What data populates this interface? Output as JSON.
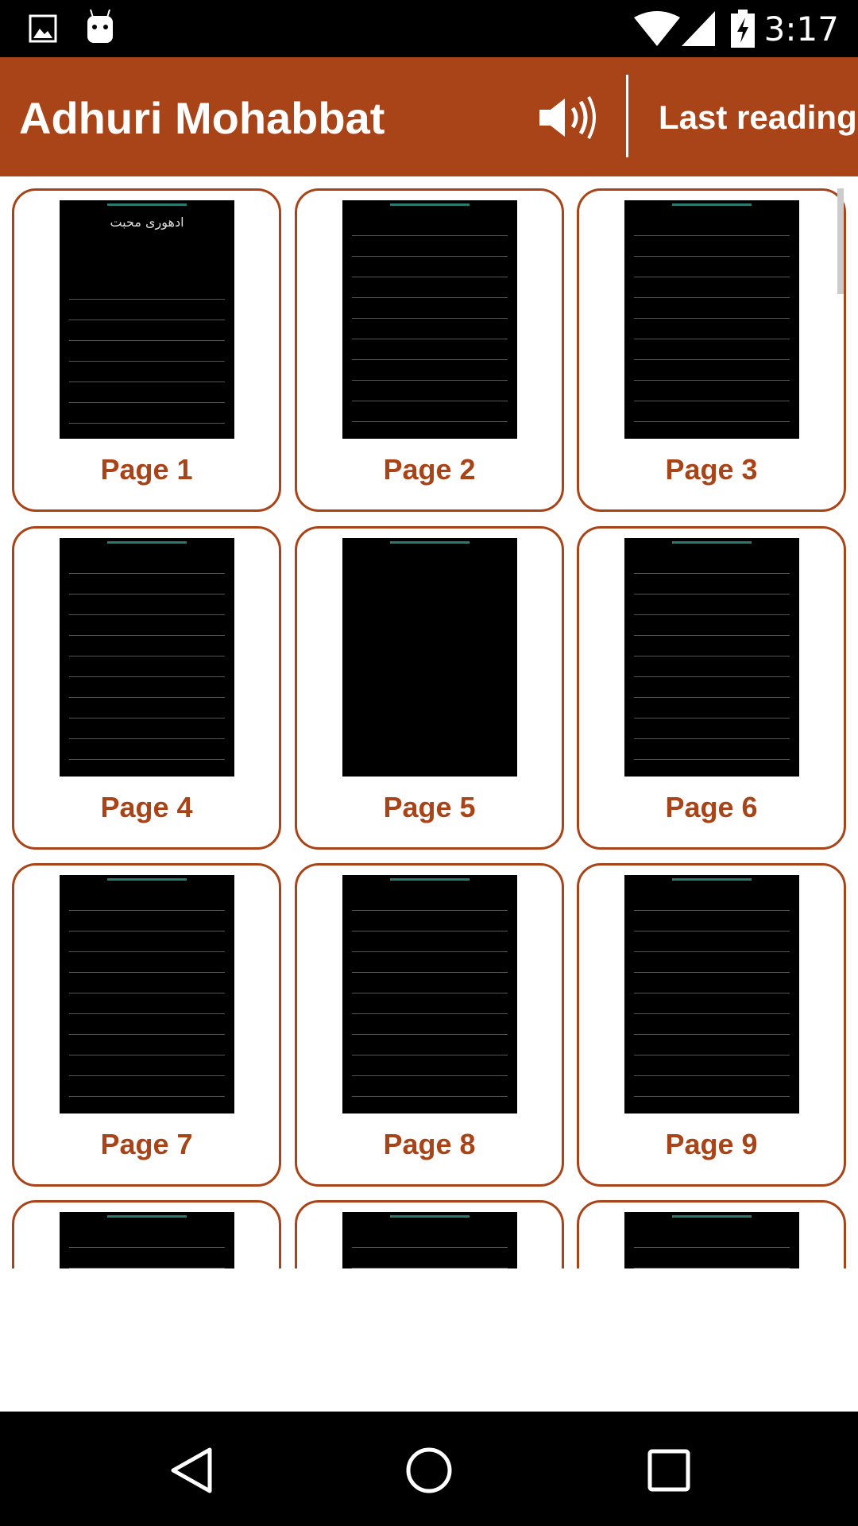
{
  "status_bar": {
    "time": "3:17",
    "icons": [
      "image-icon",
      "android-icon",
      "wifi-icon",
      "signal-icon",
      "battery-charging-icon"
    ]
  },
  "toolbar": {
    "title": "Adhuri Mohabbat",
    "sound_icon": "speaker-icon",
    "last_reading": "Last reading"
  },
  "pages": [
    {
      "label": "Page 1",
      "title": "ادھوری محبت"
    },
    {
      "label": "Page 2"
    },
    {
      "label": "Page 3"
    },
    {
      "label": "Page 4"
    },
    {
      "label": "Page 5"
    },
    {
      "label": "Page 6"
    },
    {
      "label": "Page 7"
    },
    {
      "label": "Page 8"
    },
    {
      "label": "Page 9"
    },
    {
      "label": ""
    },
    {
      "label": ""
    },
    {
      "label": ""
    }
  ],
  "nav": {
    "icons": [
      "back-icon",
      "home-icon",
      "recents-icon"
    ]
  },
  "colors": {
    "accent": "#A84418"
  }
}
